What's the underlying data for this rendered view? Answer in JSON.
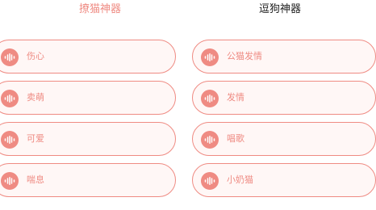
{
  "tabs": [
    {
      "label": "撩猫神器",
      "active": true
    },
    {
      "label": "逗狗神器",
      "active": false
    }
  ],
  "left_column": {
    "items": [
      {
        "label": "伤心",
        "icon": "sound-wave-icon"
      },
      {
        "label": "卖萌",
        "icon": "sound-wave-icon"
      },
      {
        "label": "可爱",
        "icon": "sound-wave-icon"
      },
      {
        "label": "喘息",
        "icon": "sound-wave-icon"
      }
    ]
  },
  "right_column": {
    "items": [
      {
        "label": "公猫发情",
        "icon": "sound-wave-icon"
      },
      {
        "label": "发情",
        "icon": "sound-wave-icon"
      },
      {
        "label": "唱歌",
        "icon": "sound-wave-icon"
      },
      {
        "label": "小奶猫",
        "icon": "sound-wave-icon"
      }
    ]
  },
  "colors": {
    "accent": "#ef8b83",
    "item_background": "#fff7f6",
    "inactive_tab": "#222222"
  }
}
